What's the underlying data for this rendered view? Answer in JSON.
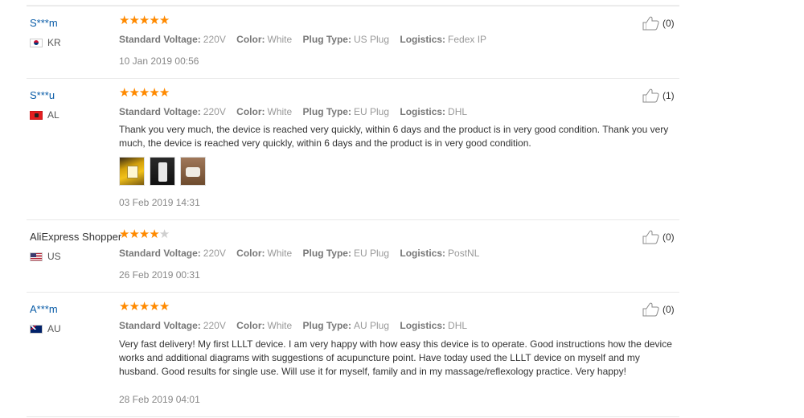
{
  "labels": {
    "voltage": "Standard Voltage:",
    "color": "Color:",
    "plug": "Plug Type:",
    "logistics": "Logistics:"
  },
  "reviews": [
    {
      "user": "S***m",
      "country": "KR",
      "flag": "south-korea-flag-icon",
      "rating": 5,
      "voltage": "220V",
      "color": "White",
      "plug": "US Plug",
      "logistics": "Fedex IP",
      "text": "",
      "photos": [],
      "date": "10 Jan 2019 00:56",
      "likes": "(0)"
    },
    {
      "user": "S***u",
      "country": "AL",
      "flag": "albania-flag-icon",
      "rating": 5,
      "voltage": "220V",
      "color": "White",
      "plug": "EU Plug",
      "logistics": "DHL",
      "text": "Thank you very much, the device is reached very quickly, within 6 days and the product is in very good condition. Thank you very much, the device is reached very quickly, within 6 days and the product is in very good condition.",
      "photos": [
        "review-photo-1",
        "review-photo-2",
        "review-photo-3"
      ],
      "date": "03 Feb 2019 14:31",
      "likes": "(1)"
    },
    {
      "user": "AliExpress Shopper",
      "country": "US",
      "flag": "us-flag-icon",
      "rating": 4,
      "voltage": "220V",
      "color": "White",
      "plug": "EU Plug",
      "logistics": "PostNL",
      "text": "",
      "photos": [],
      "date": "26 Feb 2019 00:31",
      "likes": "(0)"
    },
    {
      "user": "A***m",
      "country": "AU",
      "flag": "australia-flag-icon",
      "rating": 5,
      "voltage": "220V",
      "color": "White",
      "plug": "AU Plug",
      "logistics": "DHL",
      "text": "Very fast delivery! My first LLLT device. I am very happy with how easy this device is to operate. Good instructions how the device works and additional diagrams with suggestions of acupuncture point. Have today used the LLLT device on myself and my husband. Good results for single use. Will use it for myself, family and in my massage/reflexology practice. Very happy!",
      "photos": [],
      "date": "28 Feb 2019 04:01",
      "likes": "(0)"
    }
  ],
  "colors": {
    "star": "#ff8a00",
    "star_empty": "#cfcfcf",
    "username_link": "#0b5da8"
  }
}
